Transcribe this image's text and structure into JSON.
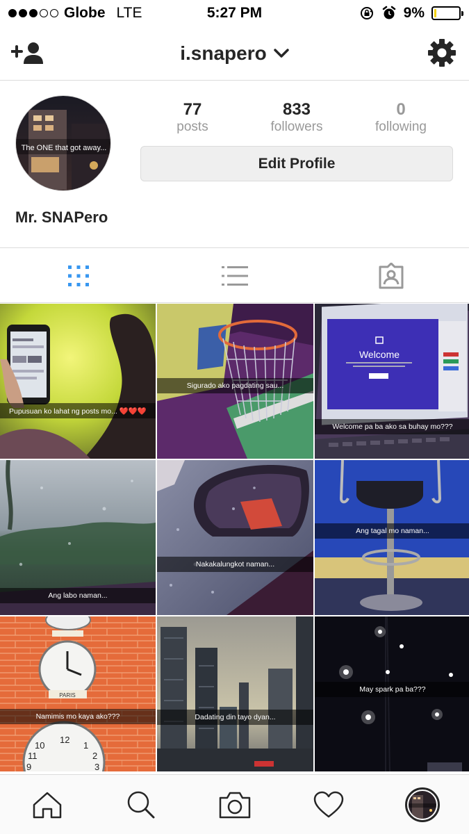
{
  "status_bar": {
    "carrier": "Globe",
    "network": "LTE",
    "time": "5:27 PM",
    "battery_pct": "9%",
    "battery_level": 0.09,
    "signal_bars_filled": 3,
    "signal_bars_total": 5
  },
  "header": {
    "username": "i.snapero",
    "add_user_icon": "add-user-icon",
    "settings_icon": "gear-icon"
  },
  "profile": {
    "avatar_text": "The ONE that got away...",
    "stats": {
      "posts_count": "77",
      "posts_label": "posts",
      "followers_count": "833",
      "followers_label": "followers",
      "following_count": "0",
      "following_label": "following"
    },
    "edit_button": "Edit Profile",
    "display_name": "Mr. SNAPero"
  },
  "view_tabs": [
    "grid-view",
    "list-view",
    "tagged-view"
  ],
  "posts": [
    {
      "caption": "Pupusuan ko lahat ng posts mo... ❤️❤️❤️"
    },
    {
      "caption": "Sigurado ako pagdating sau..."
    },
    {
      "caption": "Welcome pa ba ako sa buhay mo???",
      "screen_title": "Welcome"
    },
    {
      "caption": "Ang labo naman..."
    },
    {
      "caption": "Nakakalungkot naman..."
    },
    {
      "caption": "Ang tagal mo naman..."
    },
    {
      "caption": "Namimis mo kaya ako???",
      "clock_label": "PARIS"
    },
    {
      "caption": "Dadating din tayo dyan..."
    },
    {
      "caption": "May spark pa ba???"
    }
  ],
  "tab_bar": [
    "home-icon",
    "search-icon",
    "camera-icon",
    "heart-icon",
    "profile-tab"
  ],
  "colors": {
    "accent_blue": "#3897f0",
    "battery_yellow": "#f4d20b",
    "text_dark": "#262626",
    "text_muted": "#999999"
  }
}
